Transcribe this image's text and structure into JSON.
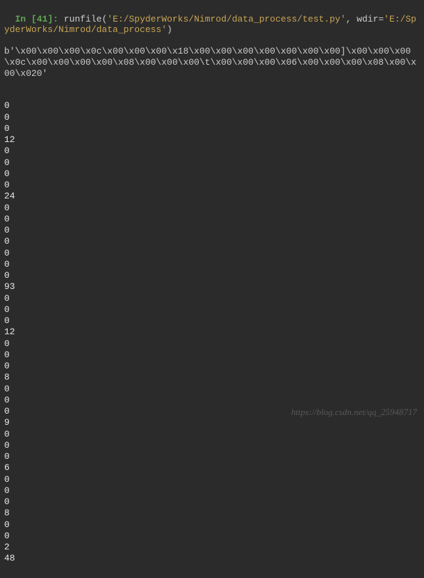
{
  "prompt": {
    "in_label": "In",
    "number": "41",
    "func": "runfile",
    "arg_file": "'E:/SpyderWorks/Nimrod/data_process/test.py'",
    "arg_wdir_key": "wdir",
    "arg_wdir_val": "'E:/SpyderWorks/Nimrod/data_process'"
  },
  "bytes_output": "b'\\x00\\x00\\x00\\x0c\\x00\\x00\\x00\\x18\\x00\\x00\\x00\\x00\\x00\\x00\\x00]\\x00\\x00\\x00\\x0c\\x00\\x00\\x00\\x00\\x08\\x00\\x00\\x00\\t\\x00\\x00\\x00\\x06\\x00\\x00\\x00\\x08\\x00\\x00\\x020'",
  "output_values": [
    "0",
    "0",
    "0",
    "12",
    "0",
    "0",
    "0",
    "0",
    "24",
    "0",
    "0",
    "0",
    "0",
    "0",
    "0",
    "0",
    "93",
    "0",
    "0",
    "0",
    "12",
    "0",
    "0",
    "0",
    "8",
    "0",
    "0",
    "0",
    "9",
    "0",
    "0",
    "0",
    "6",
    "0",
    "0",
    "0",
    "8",
    "0",
    "0",
    "2",
    "48"
  ],
  "watermark": "https://blog.csdn.net/qq_25948717"
}
